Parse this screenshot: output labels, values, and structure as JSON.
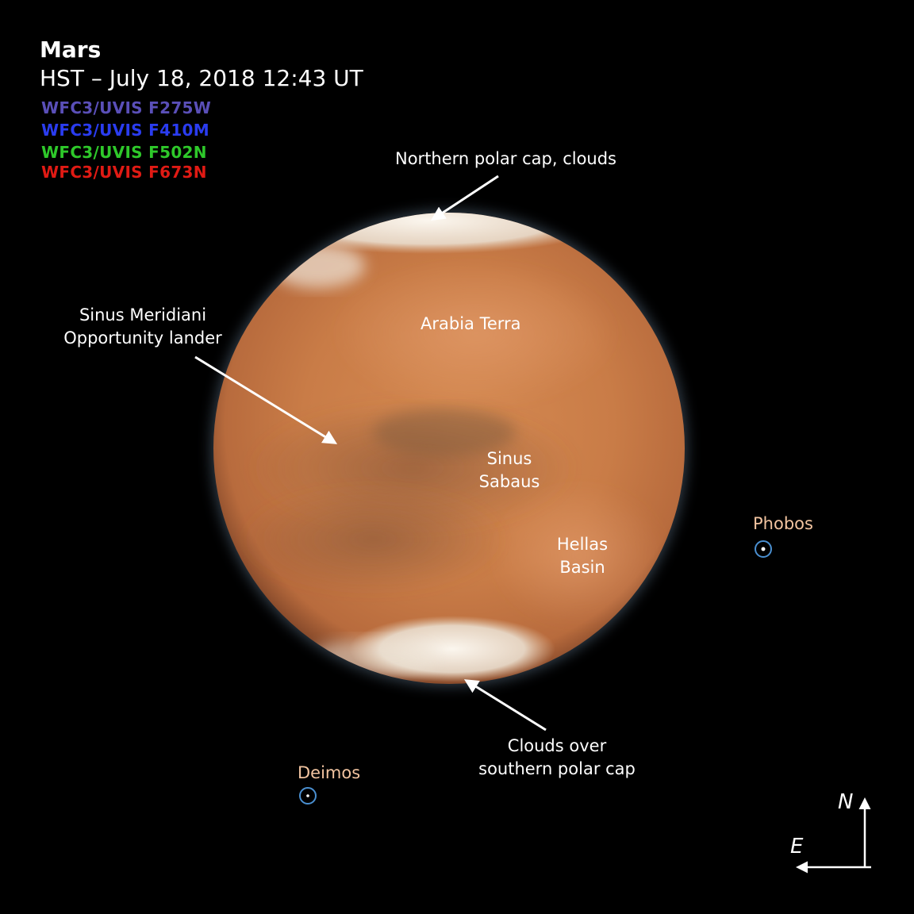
{
  "header": {
    "title": "Mars",
    "subtitle": "HST – July 18, 2018 12:43 UT"
  },
  "filters": [
    {
      "label": "WFC3/UVIS F275W",
      "color": "#5a4fb8"
    },
    {
      "label": "WFC3/UVIS F410M",
      "color": "#2a3cf0"
    },
    {
      "label": "WFC3/UVIS F502N",
      "color": "#2ec82a"
    },
    {
      "label": "WFC3/UVIS F673N",
      "color": "#e01a14"
    }
  ],
  "annotations": {
    "north_cap": "Northern polar cap, clouds",
    "meridiani_line1": "Sinus Meridiani",
    "meridiani_line2": "Opportunity lander",
    "arabia": "Arabia Terra",
    "sabaeus_line1": "Sinus",
    "sabaeus_line2": "Sabaus",
    "hellas_line1": "Hellas",
    "hellas_line2": "Basin",
    "south_line1": "Clouds over",
    "south_line2": "southern polar cap"
  },
  "moons": {
    "phobos": "Phobos",
    "deimos": "Deimos",
    "label_color": "#f2c4a0",
    "marker_color": "#4a8fd0"
  },
  "compass": {
    "north": "N",
    "east": "E"
  },
  "colors": {
    "background": "#000000",
    "planet": "#c77a48",
    "polar_cap": "#f4ece2"
  }
}
